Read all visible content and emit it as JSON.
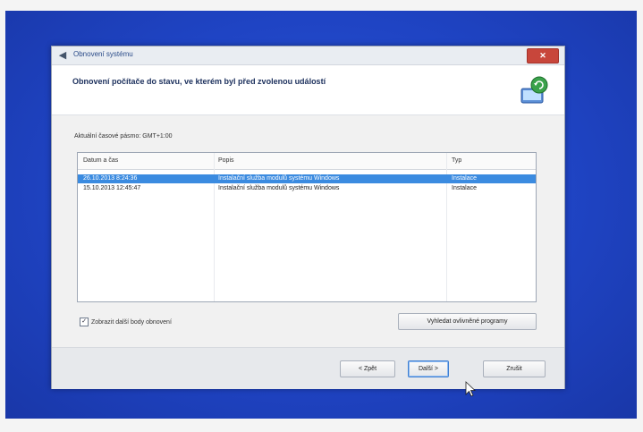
{
  "window": {
    "title": "Obnovení systému",
    "close_label": "✕"
  },
  "header": {
    "title": "Obnovení počítače do stavu, ve kterém byl před zvolenou událostí"
  },
  "timezone_label": "Aktuální časové pásmo: GMT+1:00",
  "table": {
    "columns": [
      "Datum a čas",
      "Popis",
      "Typ"
    ],
    "rows": [
      {
        "date": "26.10.2013 8:24:36",
        "description": "Instalační služba modulů systému Windows",
        "type": "Instalace",
        "selected": true
      },
      {
        "date": "15.10.2013 12:45:47",
        "description": "Instalační služba modulů systému Windows",
        "type": "Instalace",
        "selected": false
      }
    ]
  },
  "show_more": {
    "label": "Zobrazit další body obnovení",
    "checked": true
  },
  "buttons": {
    "scan": "Vyhledat ovlivněné programy",
    "back": "< Zpět",
    "next": "Další >",
    "cancel": "Zrušit"
  },
  "colors": {
    "desktop": "#1f44c4",
    "selection": "#3b8be0",
    "close": "#c8463b"
  },
  "icons": {
    "back": "back-arrow-icon",
    "header": "system-restore-icon",
    "cursor": "mouse-pointer-icon"
  }
}
